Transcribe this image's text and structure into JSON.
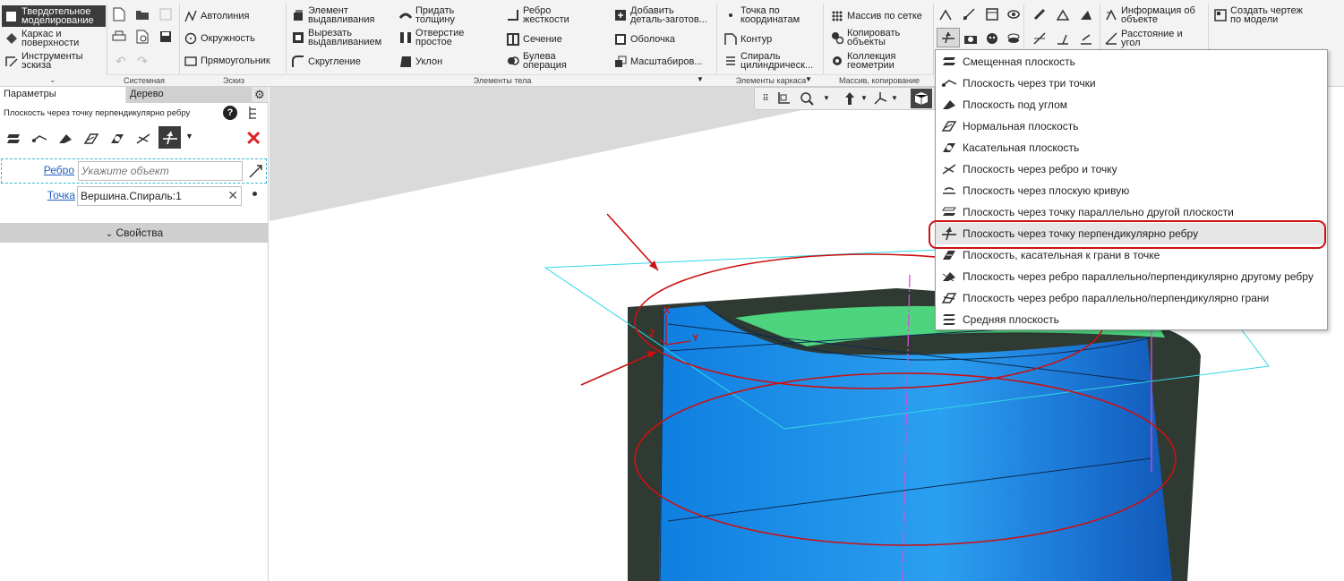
{
  "ribbon": {
    "mode_tabs": [
      "Твердотельное\nмоделирование",
      "Каркас и\nповерхности",
      "Инструменты\nэскиза"
    ],
    "sketch": {
      "autoline": "Автолиния",
      "circle": "Окружность",
      "rectangle": "Прямоугольник"
    },
    "body": {
      "extrude": "Элемент\nвыдавливания",
      "cut_extrude": "Вырезать\nвыдавливанием",
      "fillet": "Скругление",
      "thicken": "Придать\nтолщину",
      "hole": "Отверстие\nпростое",
      "draft": "Уклон",
      "rib": "Ребро\nжесткости",
      "section": "Сечение",
      "boolean": "Булева\nоперация",
      "add_part": "Добавить\nдеталь-заготов...",
      "shell": "Оболочка",
      "scale": "Масштабиров..."
    },
    "frame": {
      "point": "Точка по\nкоординатам",
      "contour": "Контур",
      "spiral": "Спираль\nцилиндрическ..."
    },
    "array": {
      "grid": "Массив по сетке",
      "copy": "Копировать\nобъекты",
      "collection": "Коллекция\nгеометрии"
    },
    "info": {
      "info": "Информация об\nобъекте",
      "distance": "Расстояние и\nугол"
    },
    "drawing": {
      "create": "Создать чертеж\nпо модели"
    },
    "group_labels": [
      "Системная",
      "Эскиз",
      "Элементы тела",
      "Элементы каркаса",
      "Массив, копирование"
    ]
  },
  "panel": {
    "tabs": [
      "Параметры",
      "Дерево"
    ],
    "title": "Плоскость через точку перпендикулярно ребру",
    "edge_label": "Ребро",
    "edge_placeholder": "Укажите объект",
    "point_label": "Точка",
    "point_value": "Вершина.Спираль:1",
    "properties": "Свойства"
  },
  "menu": {
    "items": [
      "Смещенная плоскость",
      "Плоскость через три точки",
      "Плоскость под углом",
      "Нормальная плоскость",
      "Касательная плоскость",
      "Плоскость через ребро и точку",
      "Плоскость через плоскую кривую",
      "Плоскость через точку параллельно другой плоскости",
      "Плоскость через точку перпендикулярно ребру",
      "Плоскость, касательная к грани в точке",
      "Плоскость через ребро параллельно/перпендикулярно другому ребру",
      "Плоскость через ребро параллельно/перпендикулярно грани",
      "Средняя плоскость"
    ],
    "selected_index": 8
  },
  "model": {
    "axis_x": "X",
    "axis_y": "Y",
    "axis_z": "Z"
  },
  "colors": {
    "accent_red": "#cc1111",
    "body_blue": "#1e8fe6",
    "plane_cyan": "#33d6e6",
    "green_face": "#4ed37e"
  }
}
